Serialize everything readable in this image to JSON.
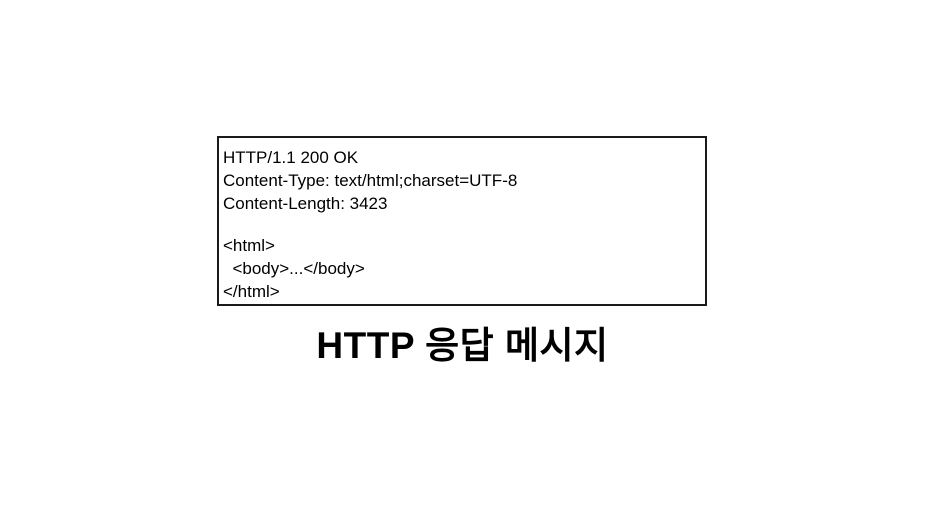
{
  "message": {
    "status_line": "HTTP/1.1 200 OK",
    "headers": [
      "Content-Type: text/html;charset=UTF-8",
      "Content-Length: 3423"
    ],
    "body_lines": [
      "<html>",
      "  <body>...</body>",
      "</html>"
    ]
  },
  "caption": "HTTP 응답 메시지"
}
